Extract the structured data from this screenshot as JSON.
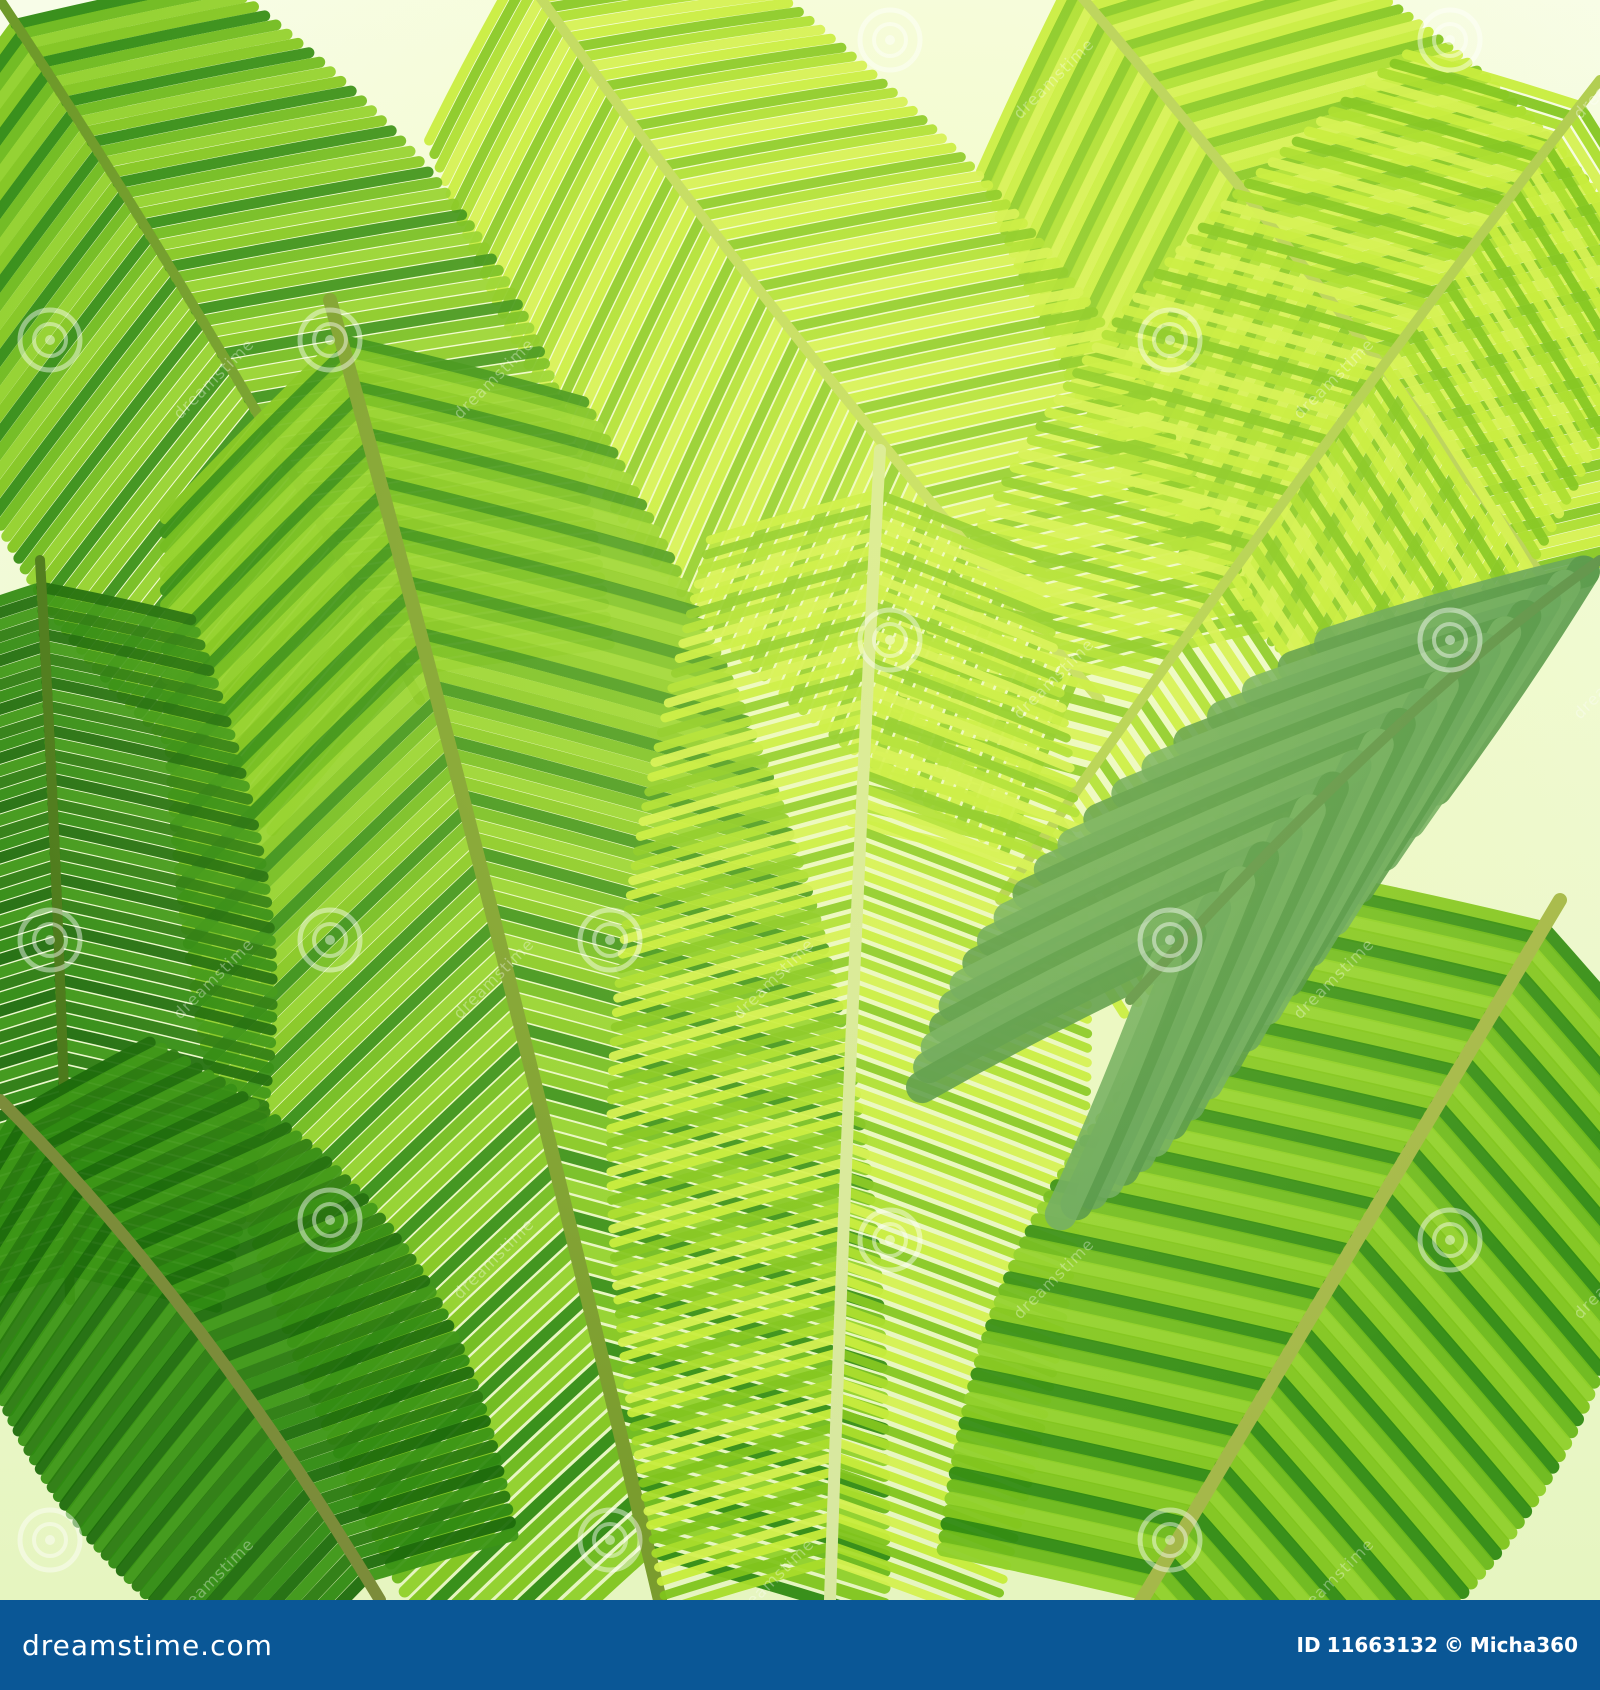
{
  "image": {
    "description_free": true,
    "colors": {
      "sky": "#f4fbe0",
      "leaf_light": "#c6ec3a",
      "leaf_mid": "#7fc41c",
      "leaf_dark": "#2f8a12",
      "leaf_deep": "#1d6b0c",
      "footer_bg": "#0a5796"
    },
    "watermark_icon": "spiral-watermark-icon",
    "watermark_text": "dreamstime"
  },
  "footer": {
    "site": "dreamstime.com",
    "id_label": "ID",
    "id_value": "11663132",
    "copyright_symbol": "©",
    "author": "Micha360"
  }
}
